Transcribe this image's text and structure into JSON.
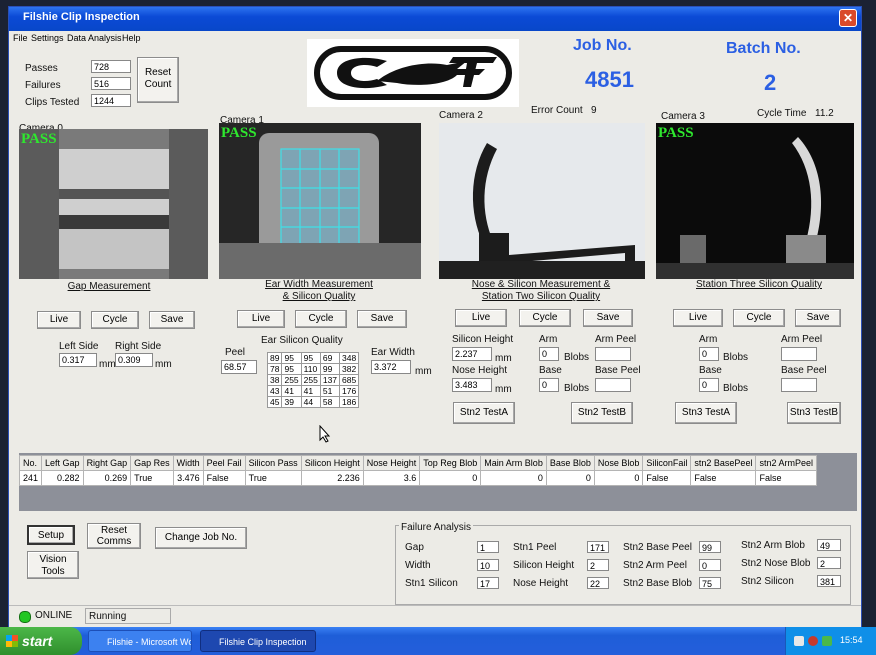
{
  "window": {
    "title": "Filshie Clip Inspection"
  },
  "menu": [
    "File",
    "Settings",
    "Data Analysis",
    "Help"
  ],
  "counts": {
    "passes_label": "Passes",
    "passes": "728",
    "failures_label": "Failures",
    "failures": "516",
    "tested_label": "Clips Tested",
    "tested": "1244",
    "reset_line1": "Reset",
    "reset_line2": "Count"
  },
  "job": {
    "label": "Job No.",
    "value": "4851"
  },
  "batch": {
    "label": "Batch No.",
    "value": "2"
  },
  "error_count": {
    "label": "Error Count",
    "value": "9"
  },
  "cycle_time": {
    "label": "Cycle Time",
    "value": "11.2"
  },
  "pass_text": "PASS",
  "cameras": [
    {
      "label": "Camera 0",
      "caption1": "Gap Measurement",
      "caption2": ""
    },
    {
      "label": "Camera 1",
      "caption1": "Ear Width Measurement",
      "caption2": "& Silicon Quality"
    },
    {
      "label": "Camera 2",
      "caption1": "Nose & Silicon Measurement &",
      "caption2": "Station Two Silicon Quality"
    },
    {
      "label": "Camera 3",
      "caption1": "Station Three Silicon Quality",
      "caption2": ""
    }
  ],
  "cam_buttons": {
    "live": "Live",
    "cycle": "Cycle",
    "save": "Save"
  },
  "cam0": {
    "left_label": "Left Side",
    "left": "0.317",
    "right_label": "Right Side",
    "right": "0.309",
    "unit": "mm"
  },
  "cam1": {
    "peel_label": "Peel",
    "peel": "68.57",
    "grid_label": "Ear Silicon Quality",
    "grid": [
      [
        "89",
        "95",
        "95",
        "69",
        "348"
      ],
      [
        "78",
        "95",
        "110",
        "99",
        "382"
      ],
      [
        "38",
        "255",
        "255",
        "137",
        "685"
      ],
      [
        "43",
        "41",
        "41",
        "51",
        "176"
      ],
      [
        "45",
        "39",
        "44",
        "58",
        "186"
      ]
    ],
    "ear_width_label": "Ear Width",
    "ear_width": "3.372",
    "unit": "mm"
  },
  "cam2": {
    "si_height_label": "Silicon Height",
    "si_height": "2.237",
    "nose_height_label": "Nose Height",
    "nose_height": "3.483",
    "unit": "mm",
    "arm_label": "Arm",
    "arm": "0",
    "blobs_label": "Blobs",
    "base_label": "Base",
    "base": "0",
    "arm_peel_label": "Arm Peel",
    "arm_peel": "",
    "base_peel_label": "Base Peel",
    "base_peel": "",
    "test_a": "Stn2 TestA",
    "test_b": "Stn2 TestB"
  },
  "cam3": {
    "arm_label": "Arm",
    "arm": "0",
    "blobs_label": "Blobs",
    "base_label": "Base",
    "base": "0",
    "arm_peel_label": "Arm Peel",
    "arm_peel": "",
    "base_peel_label": "Base Peel",
    "base_peel": "",
    "test_a": "Stn3 TestA",
    "test_b": "Stn3 TestB"
  },
  "table": {
    "headers": [
      "No.",
      "Left Gap",
      "Right Gap",
      "Gap Res",
      "Width",
      "Peel Fail",
      "Silicon Pass",
      "Silicon Height",
      "Nose Height",
      "Top Reg Blob",
      "Main Arm Blob",
      "Base Blob",
      "Nose Blob",
      "SiliconFail",
      "stn2 BasePeel",
      "stn2 ArmPeel"
    ],
    "rows": [
      [
        "241",
        "0.282",
        "0.269",
        "True",
        "3.476",
        "False",
        "True",
        "2.236",
        "3.6",
        "0",
        "0",
        "0",
        "0",
        "False",
        "False",
        "False"
      ]
    ]
  },
  "bottom": {
    "setup": "Setup",
    "reset_comms_1": "Reset",
    "reset_comms_2": "Comms",
    "change_job": "Change Job No.",
    "vision_1": "Vision",
    "vision_2": "Tools"
  },
  "failure": {
    "title": "Failure Analysis",
    "items": [
      {
        "label": "Gap",
        "value": "1"
      },
      {
        "label": "Width",
        "value": "10"
      },
      {
        "label": "Stn1 Silicon",
        "value": "17"
      },
      {
        "label": "Stn1 Peel",
        "value": "171"
      },
      {
        "label": "Silicon Height",
        "value": "2"
      },
      {
        "label": "Nose Height",
        "value": "22"
      },
      {
        "label": "Stn2 Base Peel",
        "value": "99"
      },
      {
        "label": "Stn2 Arm Peel",
        "value": "0"
      },
      {
        "label": "Stn2 Base Blob",
        "value": "75"
      },
      {
        "label": "Stn2 Arm Blob",
        "value": "49"
      },
      {
        "label": "Stn2 Nose Blob",
        "value": "2"
      },
      {
        "label": "Stn2 Silicon",
        "value": "381"
      }
    ]
  },
  "status": {
    "online": "ONLINE",
    "state": "Running"
  },
  "taskbar": {
    "start": "start",
    "items": [
      "Filshie - Microsoft Wo...",
      "Filshie Clip Inspection"
    ],
    "clock": "15:54"
  },
  "colors": {
    "accent_blue": "#2b5fe3",
    "pass_green": "#2ee82e"
  }
}
